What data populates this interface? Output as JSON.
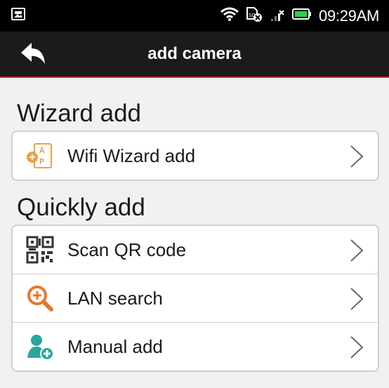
{
  "status_bar": {
    "time": "09:29AM",
    "icons": [
      "image-notification-icon",
      "wifi-icon",
      "sd-card-error-icon",
      "signal-icon",
      "battery-icon"
    ]
  },
  "action_bar": {
    "title": "add camera",
    "back_icon": "back-arrow-icon",
    "accent_color": "#d9262b"
  },
  "sections": [
    {
      "title": "Wizard add",
      "items": [
        {
          "label": "Wifi Wizard add",
          "icon": "wifi-wizard-icon"
        }
      ]
    },
    {
      "title": "Quickly add",
      "items": [
        {
          "label": "Scan QR code",
          "icon": "qr-code-icon"
        },
        {
          "label": "LAN search",
          "icon": "search-plus-icon"
        },
        {
          "label": "Manual add",
          "icon": "add-user-icon"
        }
      ]
    }
  ]
}
